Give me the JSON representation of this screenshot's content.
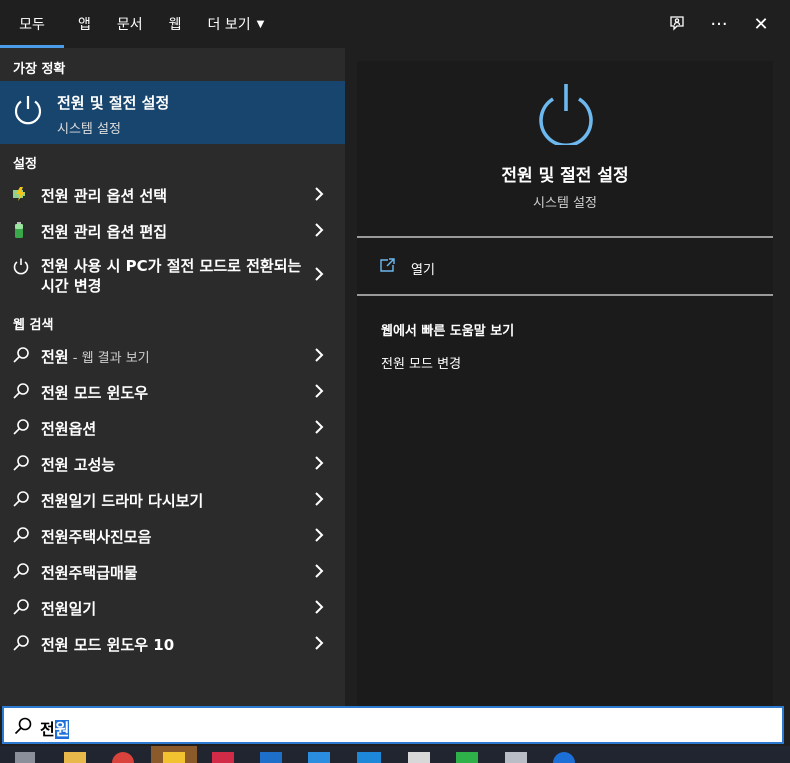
{
  "tabs": [
    {
      "label": "모두",
      "active": true
    },
    {
      "label": "앱"
    },
    {
      "label": "문서"
    },
    {
      "label": "웹"
    },
    {
      "label": "더 보기"
    }
  ],
  "top_icons": [
    "feedback-icon",
    "more-icon",
    "close-icon"
  ],
  "more_glyph": "···",
  "close_glyph": "✕",
  "sections": {
    "best": "가장 정확",
    "settings": "설정",
    "web": "웹 검색"
  },
  "best_match": {
    "title": "전원 및 절전 설정",
    "subtitle": "시스템 설정"
  },
  "settings_items": [
    {
      "label": "전원 관리 옵션 선택",
      "icon": "power-options-icon"
    },
    {
      "label": "전원 관리 옵션 편집",
      "icon": "battery-icon"
    },
    {
      "label": "전원 사용 시 PC가 절전 모드로 전환되는 시간 변경",
      "icon": "power-icon"
    }
  ],
  "web_items": [
    {
      "label": "전원",
      "sub": " - 웹 결과 보기"
    },
    {
      "label": "전원 모드 윈도우"
    },
    {
      "label": "전원옵션"
    },
    {
      "label": "전원 고성능"
    },
    {
      "label": "전원일기 드라마 다시보기"
    },
    {
      "label": "전원주택사진모음"
    },
    {
      "label": "전원주택급매물"
    },
    {
      "label": "전원일기"
    },
    {
      "label": "전원 모드 윈도우 10"
    }
  ],
  "preview": {
    "title": "전원 및 절전 설정",
    "subtitle": "시스템 설정",
    "open": "열기",
    "web_heading": "웹에서 빠른 도움말 보기",
    "web_link": "전원 모드 변경"
  },
  "search": {
    "before": "전",
    "selected": "원"
  },
  "colors": {
    "accent": "#4c9be8",
    "selection": "#17456e",
    "search_border": "#2d7bd0"
  }
}
